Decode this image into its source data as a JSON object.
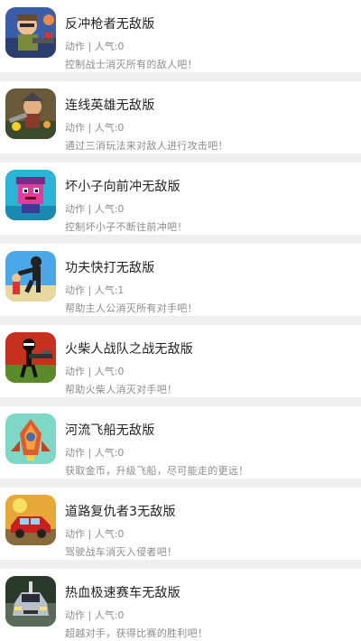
{
  "games": [
    {
      "title": "反冲枪者无敌版",
      "category": "动作",
      "sep": "|",
      "popularity": "人气:0",
      "description": "控制战士消灭所有的敌人吧！",
      "icon": "gunner-icon"
    },
    {
      "title": "连线英雄无敌版",
      "category": "动作",
      "sep": "|",
      "popularity": "人气:0",
      "description": "通过三消玩法来对敌人进行攻击吧！",
      "icon": "hero-icon"
    },
    {
      "title": "坏小子向前冲无敌版",
      "category": "动作",
      "sep": "|",
      "popularity": "人气:0",
      "description": "控制坏小子不断往前冲吧！",
      "icon": "bad-boy-icon"
    },
    {
      "title": "功夫快打无敌版",
      "category": "动作",
      "sep": "|",
      "popularity": "人气:1",
      "description": "帮助主人公消灭所有对手吧！",
      "icon": "kungfu-icon"
    },
    {
      "title": "火柴人战队之战无敌版",
      "category": "动作",
      "sep": "|",
      "popularity": "人气:0",
      "description": "帮助火柴人消灭对手吧！",
      "icon": "stickman-icon"
    },
    {
      "title": "河流飞船无敌版",
      "category": "动作",
      "sep": "|",
      "popularity": "人气:0",
      "description": "获取金币，升级飞船，尽可能走的更远！",
      "icon": "spaceship-icon"
    },
    {
      "title": "道路复仇者3无敌版",
      "category": "动作",
      "sep": "|",
      "popularity": "人气:0",
      "description": "驾驶战车消灭入侵者吧！",
      "icon": "road-car-icon"
    },
    {
      "title": "热血极速赛车无敌版",
      "category": "动作",
      "sep": "|",
      "popularity": "人气:0",
      "description": "超越对手，获得比赛的胜利吧！",
      "icon": "race-car-icon"
    }
  ]
}
